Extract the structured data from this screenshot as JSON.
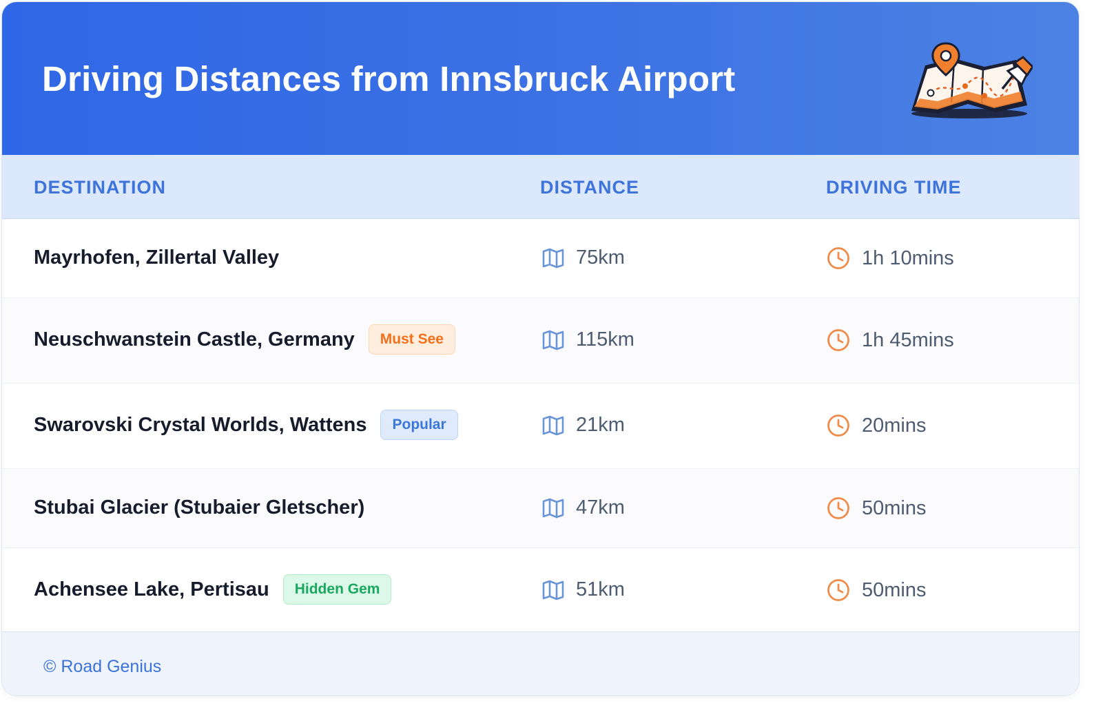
{
  "header": {
    "title": "Driving Distances from Innsbruck Airport",
    "icon": "folded-map-with-pins-icon",
    "gradient_colors": [
      "#2f67e6",
      "#4c82e3"
    ]
  },
  "table": {
    "columns": [
      "DESTINATION",
      "DISTANCE",
      "DRIVING TIME"
    ],
    "distance_icon": "map-icon",
    "time_icon": "clock-icon",
    "rows": [
      {
        "destination": "Mayrhofen, Zillertal Valley",
        "badge": "",
        "distance": "75km",
        "time": "1h 10mins"
      },
      {
        "destination": "Neuschwanstein Castle, Germany",
        "badge": "Must See",
        "badge_color": "#f0701b",
        "distance": "115km",
        "time": "1h 45mins"
      },
      {
        "destination": "Swarovski Crystal Worlds, Wattens",
        "badge": "Popular",
        "badge_color": "#3c76d9",
        "distance": "21km",
        "time": "20mins"
      },
      {
        "destination": "Stubai Glacier (Stubaier Gletscher)",
        "badge": "",
        "distance": "47km",
        "time": "50mins"
      },
      {
        "destination": "Achensee Lake, Pertisau",
        "badge": "Hidden Gem",
        "badge_color": "#1aa860",
        "distance": "51km",
        "time": "50mins"
      }
    ]
  },
  "footer": {
    "credit": "© Road Genius"
  },
  "colors": {
    "accent": "#3e73d9",
    "clock_icon": "#ef8c4c",
    "map_icon": "#6a94d8"
  }
}
